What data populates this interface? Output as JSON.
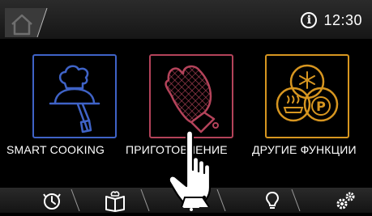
{
  "header": {
    "home_icon": "home-icon",
    "info_icon": "info-icon",
    "info_glyph": "i",
    "time": "12:30"
  },
  "tiles": [
    {
      "label": "SMART COOKING",
      "icon": "chef-cloche-icon",
      "color": "#3f63c7"
    },
    {
      "label": "ПРИГОТОВЛЕНИЕ",
      "icon": "oven-mitt-icon",
      "color": "#b4435a"
    },
    {
      "label": "ДРУГИЕ ФУНКЦИИ",
      "icon": "other-functions-icon",
      "color": "#d79620"
    }
  ],
  "bottom_nav": [
    {
      "icon": "timer-icon"
    },
    {
      "icon": "recipe-book-icon"
    },
    {
      "icon": "bell-icon"
    },
    {
      "icon": "lightbulb-icon"
    },
    {
      "icon": "settings-gears-icon"
    }
  ]
}
